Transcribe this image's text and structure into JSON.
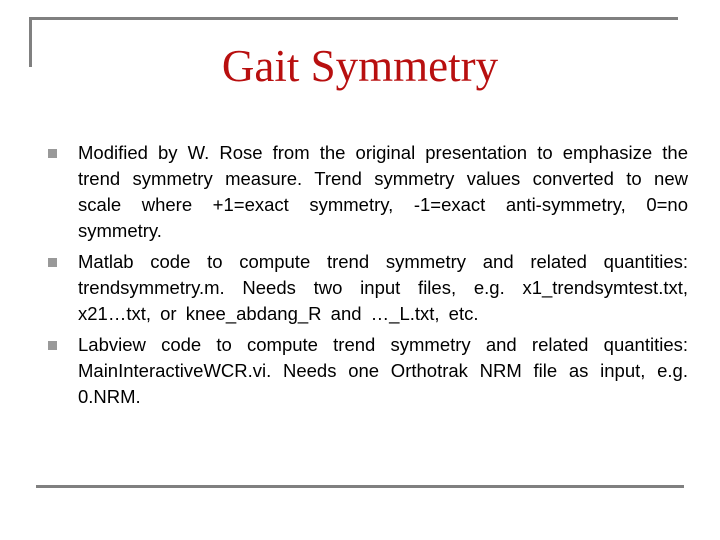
{
  "slide": {
    "title": "Gait Symmetry",
    "title_color": "#b80f0f",
    "rule_color": "#808080",
    "bullet_icon": "square-bullet",
    "bullets": [
      {
        "text": "Modified by W. Rose from the original presentation to emphasize the trend symmetry measure.  Trend symmetry values converted to new scale where +1=exact symmetry, -1=exact anti-symmetry, 0=no symmetry."
      },
      {
        "text": "Matlab code to compute trend symmetry and related quantities: trendsymmetry.m.  Needs two input files, e.g. x1_trendsymtest.txt, x21…txt, or knee_abdang_R and …_L.txt, etc."
      },
      {
        "text": "Labview code to compute trend symmetry and related quantities: MainInteractiveWCR.vi.  Needs one Orthotrak NRM file as input, e.g. 0.NRM."
      }
    ]
  }
}
